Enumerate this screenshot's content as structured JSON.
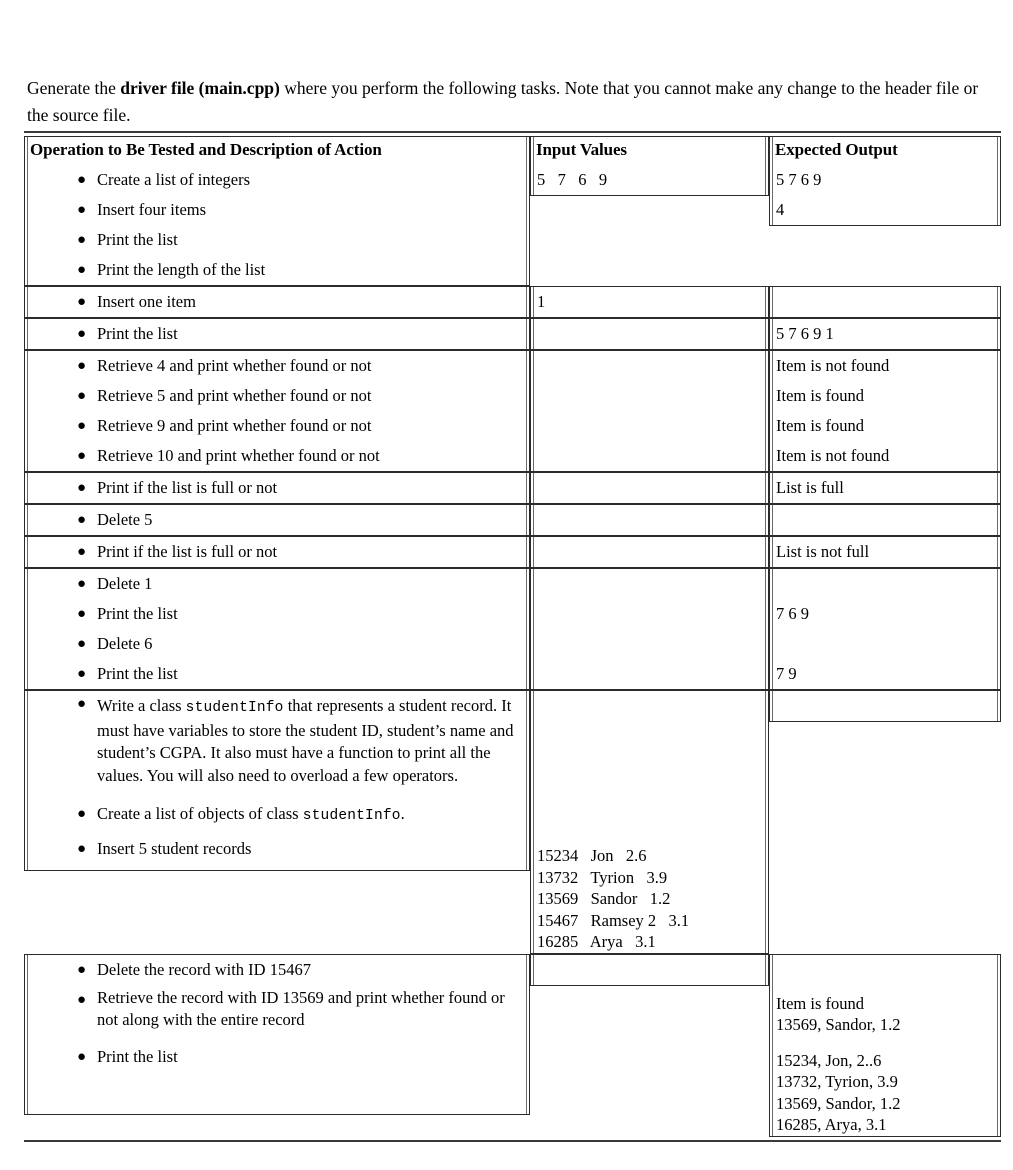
{
  "intro": {
    "before": "Generate the ",
    "bold": "driver file (main.cpp)",
    "after": " where you perform the following tasks. Note that you cannot make any change to the header file or the source file."
  },
  "table": {
    "headers": {
      "operation": "Operation to Be Tested and Description of Action",
      "input": "Input Values",
      "output": "Expected Output"
    },
    "groups": [
      {
        "id": "group-1",
        "operations": [
          "Create a list of integers",
          "Insert four items",
          "Print the list",
          "Print the length of the list"
        ],
        "inputs": [
          "",
          "5   7   6   9",
          "",
          ""
        ],
        "outputs": [
          "",
          "",
          "5 7 6 9",
          "4"
        ]
      },
      {
        "id": "group-2",
        "operations": [
          "Insert one item"
        ],
        "inputs": [
          "1"
        ],
        "outputs": [
          ""
        ]
      },
      {
        "id": "group-3",
        "operations": [
          "Print the list"
        ],
        "inputs": [
          ""
        ],
        "outputs": [
          "5 7 6 9 1"
        ]
      },
      {
        "id": "group-4",
        "operations": [
          "Retrieve 4 and print whether found or not",
          "Retrieve 5 and print whether found or not",
          "Retrieve 9 and print whether found or not",
          "Retrieve 10 and print whether found or not"
        ],
        "inputs": [
          "",
          "",
          "",
          ""
        ],
        "outputs": [
          "Item is not found",
          "Item is found",
          "Item is found",
          "Item is not found"
        ]
      },
      {
        "id": "group-5",
        "operations": [
          "Print if the list is full or not"
        ],
        "inputs": [
          ""
        ],
        "outputs": [
          "List is full"
        ]
      },
      {
        "id": "group-6",
        "operations": [
          "Delete 5"
        ],
        "inputs": [
          ""
        ],
        "outputs": [
          ""
        ]
      },
      {
        "id": "group-7",
        "operations": [
          "Print if the list is full or not"
        ],
        "inputs": [
          ""
        ],
        "outputs": [
          "List is not full"
        ]
      },
      {
        "id": "group-8",
        "operations": [
          "Delete 1",
          "Print the list",
          "Delete 6",
          "Print the list"
        ],
        "inputs": [
          "",
          "",
          "",
          ""
        ],
        "outputs": [
          "",
          "7 6 9",
          "",
          "7 9"
        ]
      }
    ],
    "student_group": {
      "id": "group-9",
      "class_item": {
        "part1": "Write a class ",
        "class_name": "studentInfo",
        "part2": " that represents a student record. It must have variables to store the student ID, student’s name and student’s CGPA. It also must have a function to print all the values. You will also need to overload a few operators."
      },
      "create_item": {
        "part1": "Create a list of objects of class ",
        "class_name": "studentInfo",
        "part2": "."
      },
      "insert_item": "Insert 5 student records",
      "records": [
        "15234   Jon   2.6",
        "13732   Tyrion   3.9",
        "13569   Sandor   1.2",
        "15467   Ramsey 2   3.1",
        "16285   Arya   3.1"
      ]
    },
    "final_group": {
      "id": "group-10",
      "operations": [
        "Delete the record with ID 15467",
        "Retrieve the record with ID 13569 and print whether found or not along with the entire record",
        "Print the list"
      ],
      "outputs_found": [
        "Item is found",
        "13569, Sandor, 1.2"
      ],
      "outputs_list": [
        "15234, Jon, 2..6",
        "13732, Tyrion, 3.9",
        "13569, Sandor, 1.2",
        "16285, Arya, 3.1"
      ]
    }
  }
}
